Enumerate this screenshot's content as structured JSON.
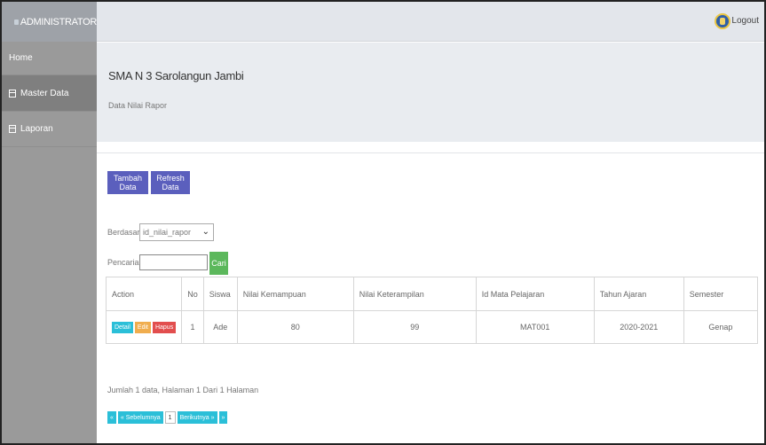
{
  "app": {
    "brand": "ADMINISTRATOR"
  },
  "sidebar": {
    "items": [
      {
        "label": "Home"
      },
      {
        "label": "Master Data"
      },
      {
        "label": "Laporan"
      }
    ]
  },
  "topbar": {
    "logout": "Logout"
  },
  "header": {
    "school": "SMA N 3 Sarolangun Jambi",
    "subtitle": "Data Nilai Rapor"
  },
  "toolbar": {
    "add": "Tambah Data",
    "refresh": "Refresh Data"
  },
  "filter": {
    "by_label": "Berdasarkan",
    "by_value": "id_nilai_rapor",
    "search_label": "Pencarian",
    "search_value": "",
    "search_button": "Cari"
  },
  "table": {
    "headers": [
      "Action",
      "No",
      "Siswa",
      "Nilai Kemampuan",
      "Nilai Keterampilan",
      "Id Mata Pelajaran",
      "Tahun Ajaran",
      "Semester"
    ],
    "rows": [
      {
        "actions": [
          "Detail",
          "Edit",
          "Hapus"
        ],
        "no": "1",
        "siswa": "Ade",
        "nilai_kemampuan": "80",
        "nilai_keterampilan": "99",
        "id_mapel": "MAT001",
        "tahun_ajaran": "2020-2021",
        "semester": "Genap"
      }
    ]
  },
  "footer": {
    "info": "Jumlah 1 data, Halaman 1 Dari 1 Halaman",
    "pager": {
      "first": "«",
      "prev": "« Sebelumnya",
      "current": "1",
      "next": "Berikutnya »",
      "last": "»"
    }
  }
}
